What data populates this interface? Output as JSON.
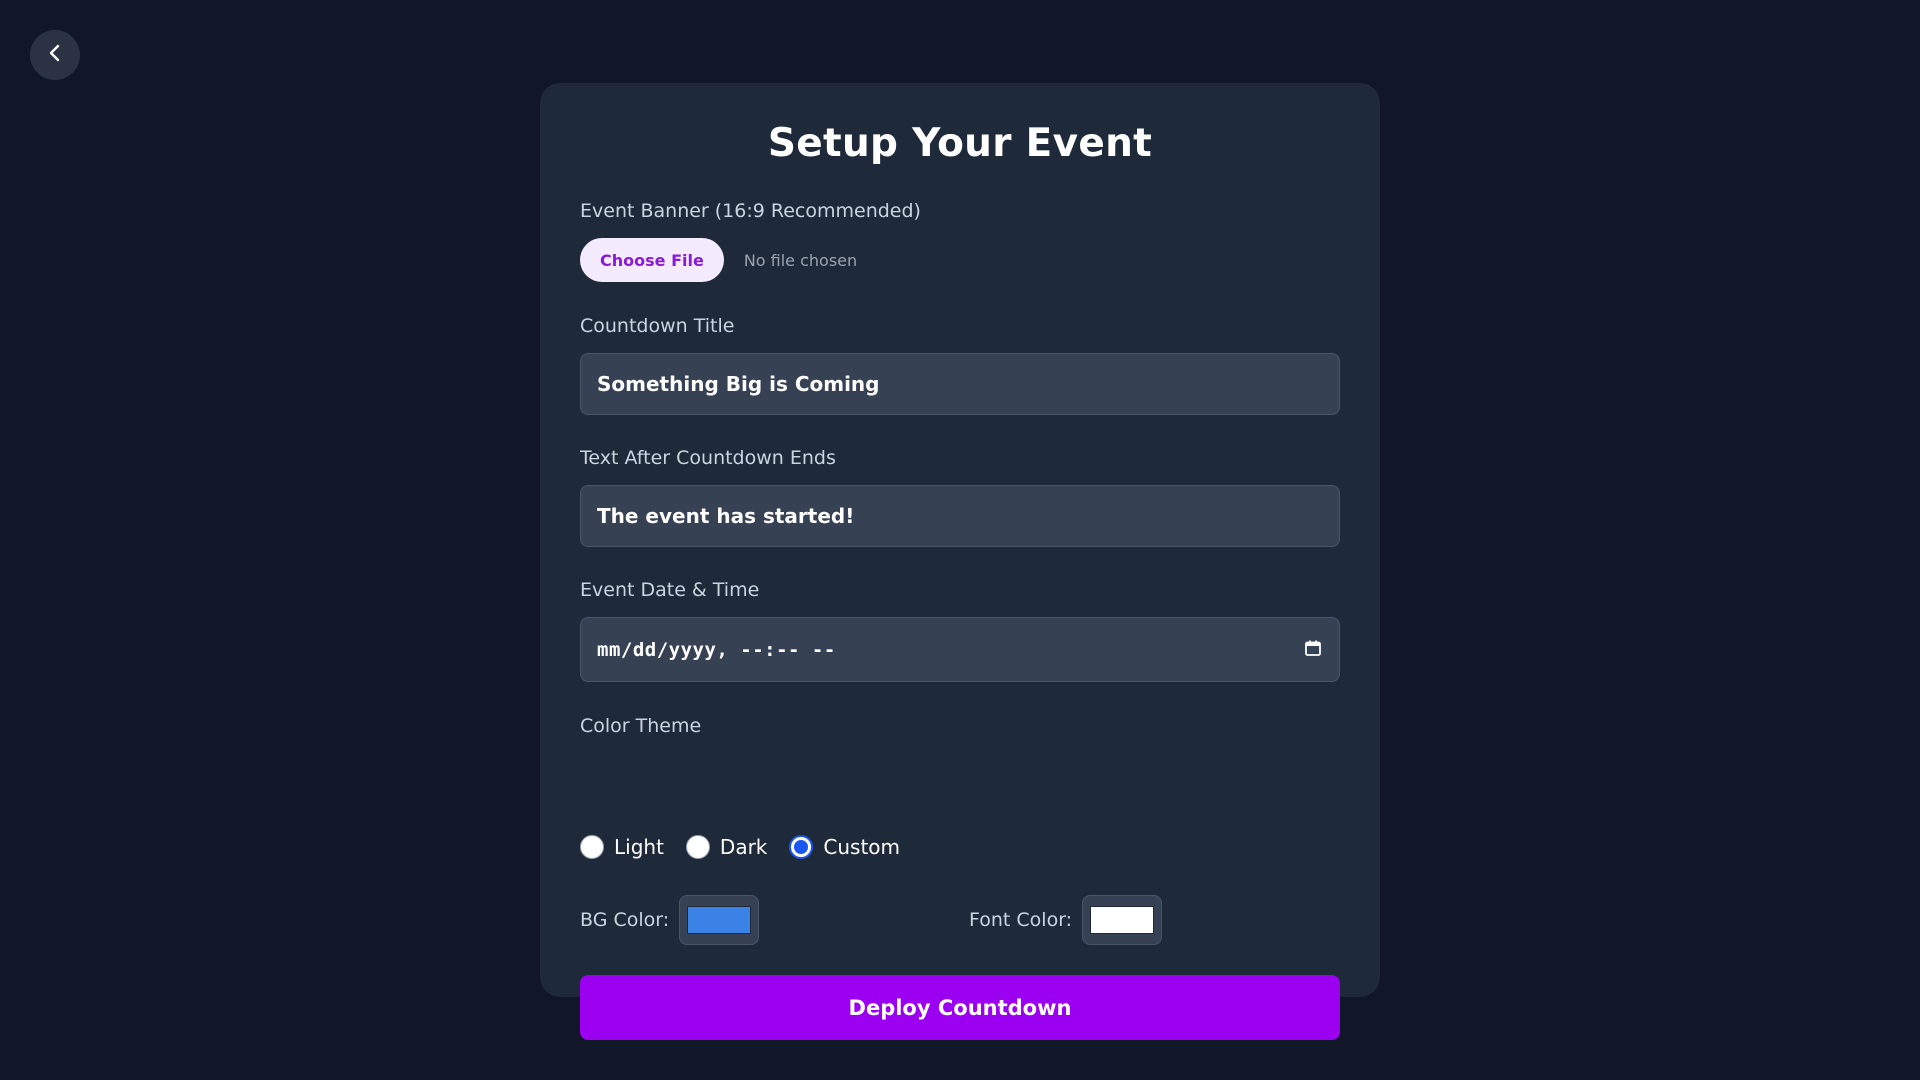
{
  "header": {
    "back_icon": "chevron-left-icon"
  },
  "form": {
    "title": "Setup Your Event",
    "banner": {
      "label": "Event Banner (16:9 Recommended)",
      "button_label": "Choose File",
      "status": "No file chosen"
    },
    "countdown_title": {
      "label": "Countdown Title",
      "value": "Something Big is Coming"
    },
    "after_text": {
      "label": "Text After Countdown Ends",
      "value": "The event has started!"
    },
    "datetime": {
      "label": "Event Date & Time",
      "placeholder": "mm/dd/yyyy, --:-- --",
      "icon": "calendar-icon"
    },
    "theme": {
      "label": "Color Theme",
      "options": [
        "Light",
        "Dark",
        "Custom"
      ],
      "selected": "Custom"
    },
    "bg_color": {
      "label": "BG Color:",
      "value": "#3b82e6"
    },
    "font_color": {
      "label": "Font Color:",
      "value": "#ffffff"
    },
    "submit_label": "Deploy Countdown"
  },
  "colors": {
    "page_bg": "#111729",
    "card_bg": "#1e2939",
    "accent": "#9b00f0",
    "radio_selected": "#1a56f0"
  }
}
